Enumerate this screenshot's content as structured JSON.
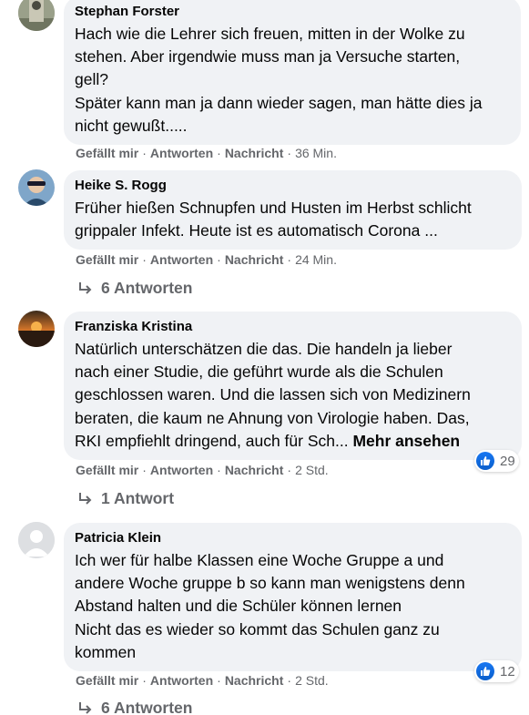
{
  "colors": {
    "bubble": "#f0f2f5",
    "meta": "#65676b",
    "like": "#1877f2"
  },
  "labels": {
    "like": "Gefällt mir",
    "reply": "Antworten",
    "message": "Nachricht",
    "dot": "·"
  },
  "comments": [
    {
      "author": "Stephan Forster",
      "text": "Hach wie die Lehrer sich freuen, mitten in der Wolke zu\nstehen. Aber irgendwie muss man ja Versuche starten,\ngell?\nSpäter kann man ja dann wieder sagen, man hätte dies ja\nnicht gewußt.....",
      "time": "36 Min."
    },
    {
      "author": "Heike S. Rogg",
      "text": "Früher hießen Schnupfen und Husten im Herbst schlicht\ngrippaler Infekt. Heute ist es automatisch Corona ...",
      "time": "24 Min.",
      "replies": "6 Antworten"
    },
    {
      "author": "Franziska Kristina",
      "text": "Natürlich unterschätzen die das. Die handeln ja lieber\nnach einer Studie, die geführt wurde als die Schulen\ngeschlossen waren. Und die lassen sich von Medizinern\nberaten, die kaum ne Ahnung von Virologie haben. Das,\nRKI empfiehlt dringend, auch für Sch...",
      "more": "Mehr ansehen",
      "time": "2 Std.",
      "reactions": "29",
      "replies": "1 Antwort"
    },
    {
      "author": "Patricia Klein",
      "text": "Ich wer für halbe Klassen eine Woche Gruppe a und\nandere Woche gruppe b so kann man wenigstens denn\nAbstand halten und die Schüler können lernen\nNicht das es wieder so kommt das Schulen ganz zu\nkommen",
      "time": "2 Std.",
      "reactions": "12",
      "replies": "6 Antworten"
    }
  ]
}
